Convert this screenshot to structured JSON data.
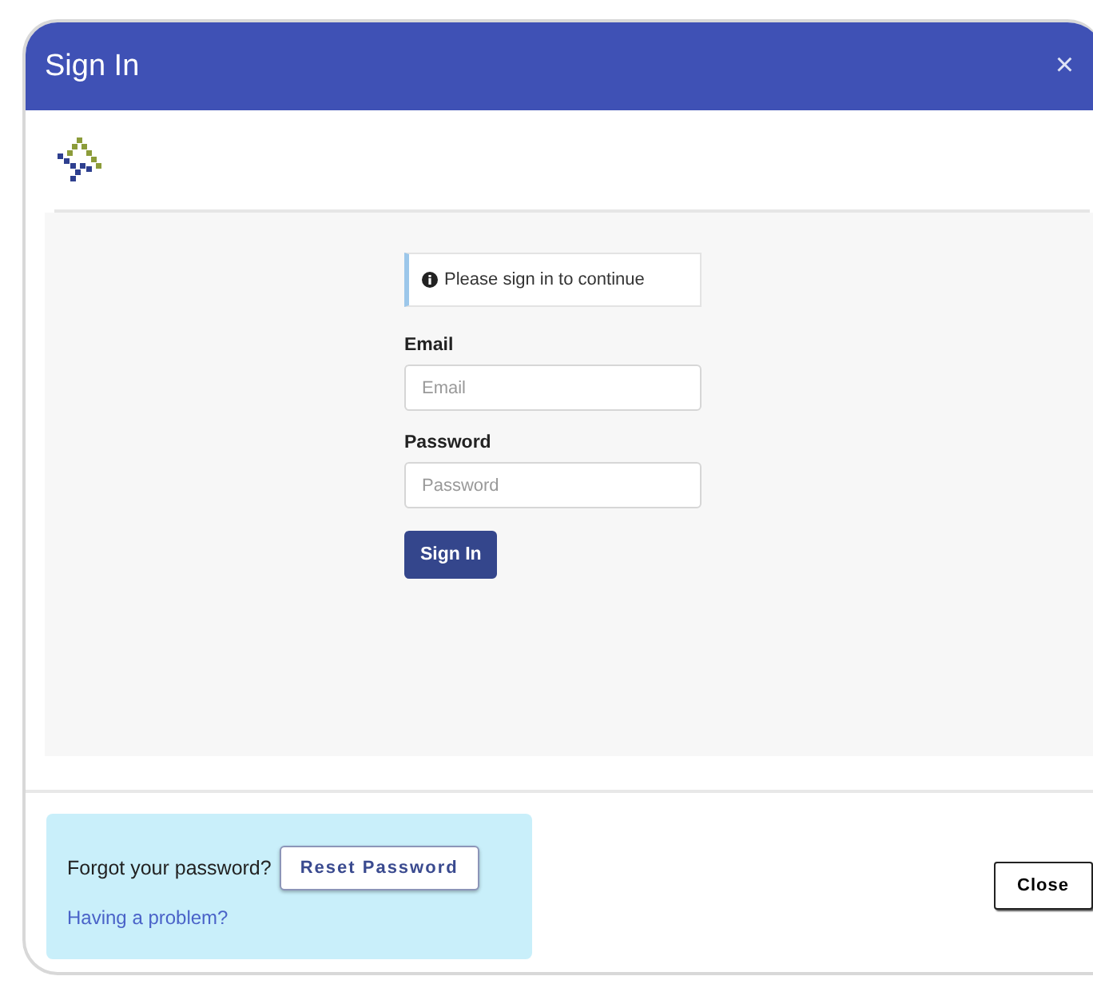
{
  "window": {
    "title": "Sign In",
    "close_glyph": "×"
  },
  "notice": "Please sign in to continue",
  "fields": [
    {
      "label": "Email",
      "placeholder": "Email"
    },
    {
      "label": "Password",
      "placeholder": "Password"
    }
  ],
  "submit": "Sign In",
  "help": {
    "question": "Forgot your password?",
    "reset": "Reset Password",
    "link": "Having a problem?"
  },
  "close_button": "Close"
}
